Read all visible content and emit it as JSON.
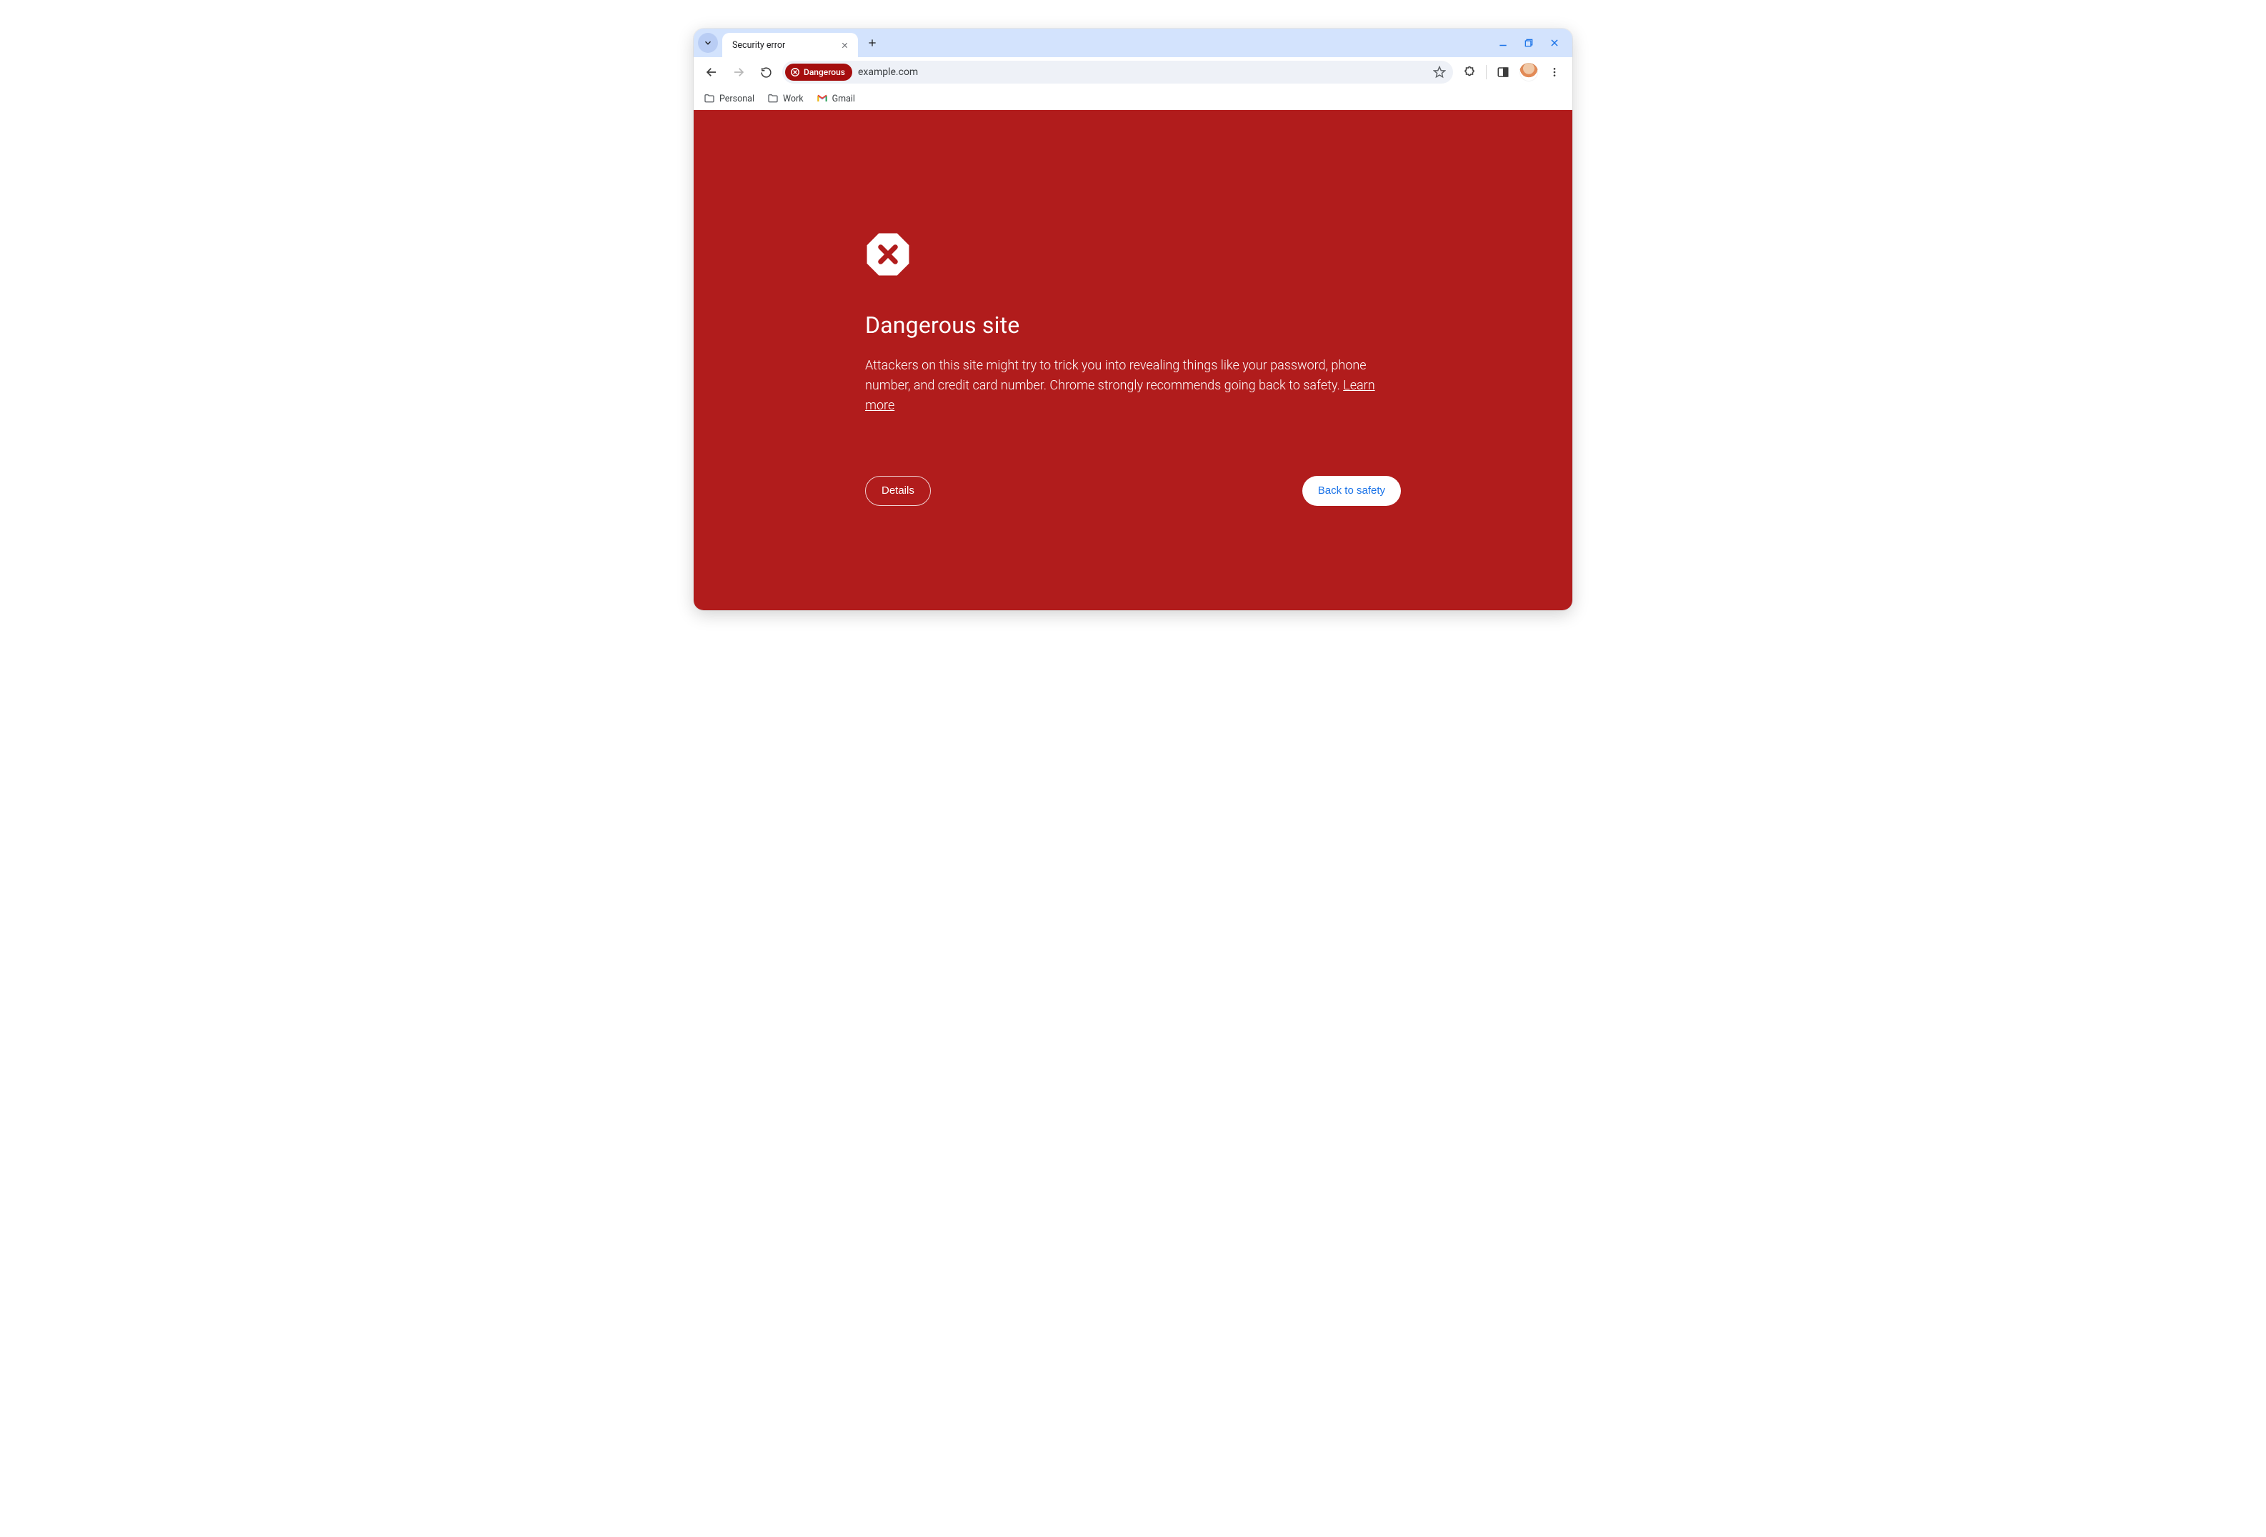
{
  "window": {
    "minimize_tooltip": "Minimize",
    "maximize_tooltip": "Maximize",
    "close_tooltip": "Close"
  },
  "tabs": {
    "search_tooltip": "Search tabs",
    "active": {
      "title": "Security error"
    },
    "newtab_tooltip": "New tab"
  },
  "toolbar": {
    "back_tooltip": "Back",
    "forward_tooltip": "Forward",
    "reload_tooltip": "Reload",
    "danger_chip": "Dangerous",
    "url": "example.com",
    "bookmark_tooltip": "Bookmark this tab",
    "extensions_tooltip": "Extensions",
    "sidepanel_tooltip": "Side panel",
    "profile_tooltip": "You",
    "menu_tooltip": "Customize and control Google Chrome"
  },
  "bookmarks": {
    "items": [
      {
        "label": "Personal",
        "kind": "folder"
      },
      {
        "label": "Work",
        "kind": "folder"
      },
      {
        "label": "Gmail",
        "kind": "gmail"
      }
    ]
  },
  "interstitial": {
    "heading": "Dangerous site",
    "body_pre": "Attackers on this site might try to trick you into revealing things like your password, phone number, and credit card number. Chrome strongly recommends going back to safety. ",
    "learn_more": "Learn more",
    "details_button": "Details",
    "safety_button": "Back to safety"
  },
  "colors": {
    "danger_bg": "#B11C1C",
    "chip_bg": "#a50e0e",
    "link_blue": "#1a73e8",
    "tabstrip_bg": "#d3e3fd"
  }
}
